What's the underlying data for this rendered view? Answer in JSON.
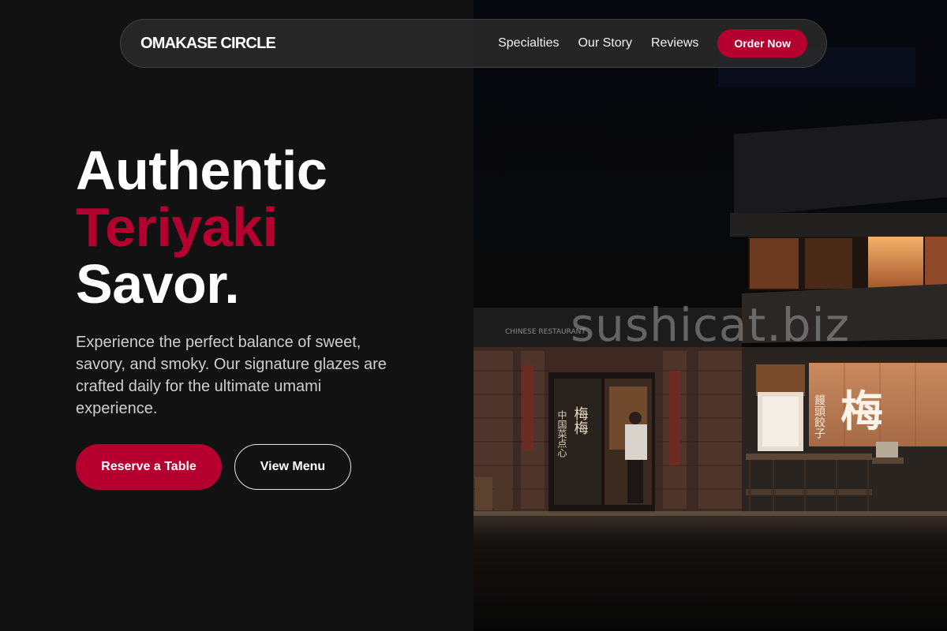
{
  "nav": {
    "brand": "OMAKASE CIRCLE",
    "links": [
      "Specialties",
      "Our Story",
      "Reviews"
    ],
    "cta": "Order Now"
  },
  "hero": {
    "title_line1": "Authentic",
    "title_line2": "Teriyaki",
    "title_line3": "Savor.",
    "description": "Experience the perfect balance of sweet, savory, and smoky. Our signature glazes are crafted daily for the ultimate umami experience.",
    "primary_button": "Reserve a Table",
    "secondary_button": "View Menu"
  },
  "image": {
    "watermark": "sushicat.biz",
    "sign_text": "CHINESE RESTAURANT",
    "kanji_large": "梅",
    "kanji_panel": "饅頭餃子",
    "kanji_door_left": "中国菜点心",
    "kanji_door_right": "梅梅"
  },
  "colors": {
    "accent": "#b5002f",
    "background": "#121212",
    "text_muted": "#cfcfcf"
  }
}
